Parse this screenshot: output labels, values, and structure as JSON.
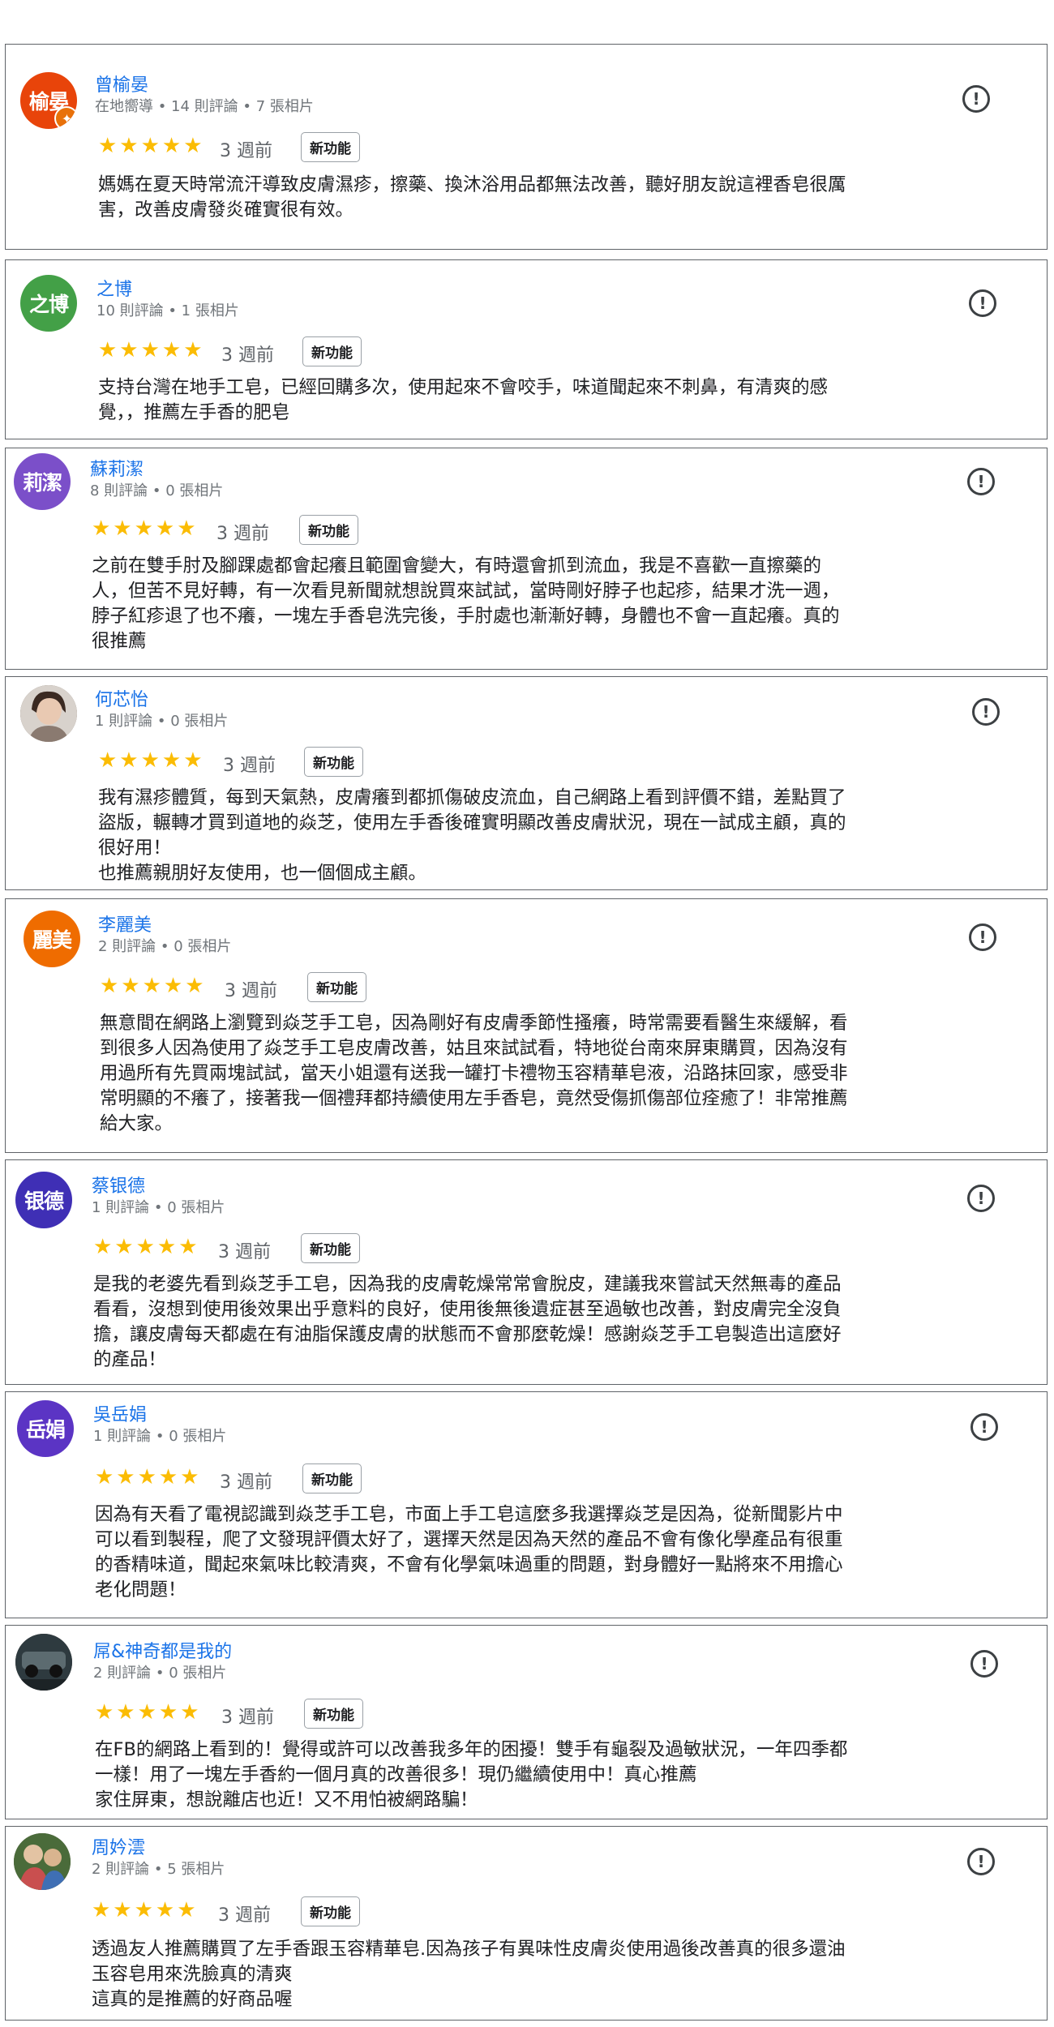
{
  "common": {
    "new_feature_label": "新功能",
    "report_icon": "report-flag-icon",
    "star_color": "#fbbc04",
    "name_color": "#1a73e8"
  },
  "reviews": [
    {
      "initials": "榆晏",
      "avatar_color": "#e8440a",
      "name": "曾榆晏",
      "meta": "在地嚮導 • 14 則評論 • 7 張相片",
      "rating": 5,
      "stars": "★★★★★",
      "time": "3 週前",
      "text": "媽媽在夏天時常流汗導致皮膚濕疹，擦藥、換沐浴用品都無法改善，聽好朋友說這裡香皂很厲\n害，改善皮膚發炎確實很有效。"
    },
    {
      "initials": "之博",
      "avatar_color": "#43a047",
      "name": "之博",
      "meta": "10 則評論 • 1 張相片",
      "rating": 5,
      "stars": "★★★★★",
      "time": "3 週前",
      "text": "支持台灣在地手工皂，已經回購多次，使用起來不會咬手，味道聞起來不刺鼻，有清爽的感\n覺，，推薦左手香的肥皂"
    },
    {
      "initials": "莉潔",
      "avatar_color": "#7b4fc9",
      "name": "蘇莉潔",
      "meta": "8 則評論 • 0 張相片",
      "rating": 5,
      "stars": "★★★★★",
      "time": "3 週前",
      "text": "之前在雙手肘及腳踝處都會起癢且範圍會變大，有時還會抓到流血，我是不喜歡一直擦藥的\n人，但苦不見好轉，有一次看見新聞就想說買來試試，當時剛好脖子也起疹，結果才洗一週，\n脖子紅疹退了也不癢，一塊左手香皂洗完後，手肘處也漸漸好轉，身體也不會一直起癢。真的\n很推薦"
    },
    {
      "initials": "",
      "avatar_color": "#6b5a4e",
      "name": "何芯怡",
      "meta": "1 則評論 • 0 張相片",
      "rating": 5,
      "stars": "★★★★★",
      "time": "3 週前",
      "text": "我有濕疹體質，每到天氣熱，皮膚癢到都抓傷破皮流血，自己網路上看到評價不錯，差點買了\n盜版，輾轉才買到道地的焱芝，使用左手香後確實明顯改善皮膚狀況，現在一試成主顧，真的\n很好用！\n也推薦親朋好友使用，也一個個成主顧。"
    },
    {
      "initials": "麗美",
      "avatar_color": "#ef6c00",
      "name": "李麗美",
      "meta": "2 則評論 • 0 張相片",
      "rating": 5,
      "stars": "★★★★★",
      "time": "3 週前",
      "text": "無意間在網路上瀏覽到焱芝手工皂，因為剛好有皮膚季節性搔癢，時常需要看醫生來緩解，看\n到很多人因為使用了焱芝手工皂皮膚改善，姑且來試試看，特地從台南來屏東購買，因為沒有\n用過所有先買兩塊試試，當天小姐還有送我一罐打卡禮物玉容精華皂液，沿路抹回家，感受非\n常明顯的不癢了，接著我一個禮拜都持續使用左手香皂，竟然受傷抓傷部位痊癒了！非常推薦\n給大家。"
    },
    {
      "initials": "银德",
      "avatar_color": "#3f2fb5",
      "name": "蔡银德",
      "meta": "1 則評論 • 0 張相片",
      "rating": 5,
      "stars": "★★★★★",
      "time": "3 週前",
      "text": "是我的老婆先看到焱芝手工皂，因為我的皮膚乾燥常常會脫皮，建議我來嘗試天然無毒的產品\n看看，沒想到使用後效果出乎意料的良好，使用後無後遺症甚至過敏也改善，對皮膚完全沒負\n擔，讓皮膚每天都處在有油脂保護皮膚的狀態而不會那麼乾燥！感謝焱芝手工皂製造出這麼好\n的產品！"
    },
    {
      "initials": "岳娟",
      "avatar_color": "#5b34c4",
      "name": "吳岳娟",
      "meta": "1 則評論 • 0 張相片",
      "rating": 5,
      "stars": "★★★★★",
      "time": "3 週前",
      "text": "因為有天看了電視認識到焱芝手工皂，市面上手工皂這麼多我選擇焱芝是因為，從新聞影片中\n可以看到製程，爬了文發現評價太好了，選擇天然是因為天然的產品不會有像化學產品有很重\n的香精味道，聞起來氣味比較清爽，不會有化學氣味過重的問題，對身體好一點將來不用擔心\n老化問題！"
    },
    {
      "initials": "",
      "avatar_color": "#2e3a3f",
      "name": "屌&神奇都是我的",
      "meta": "2 則評論 • 0 張相片",
      "rating": 5,
      "stars": "★★★★★",
      "time": "3 週前",
      "text": "在FB的網路上看到的！覺得或許可以改善我多年的困擾！雙手有龜裂及過敏狀況，一年四季都\n一樣！用了一塊左手香約一個月真的改善很多！現仍繼續使用中！真心推薦\n家住屏東，想說離店也近！又不用怕被網路騙！"
    },
    {
      "initials": "",
      "avatar_color": "#4a6b3a",
      "name": "周妗澐",
      "meta": "2 則評論 • 5 張相片",
      "rating": 5,
      "stars": "★★★★★",
      "time": "3 週前",
      "text": "透過友人推薦購買了左手香跟玉容精華皂.因為孩子有異味性皮膚炎使用過後改善真的很多還油\n玉容皂用來洗臉真的清爽\n這真的是推薦的好商品喔"
    }
  ]
}
